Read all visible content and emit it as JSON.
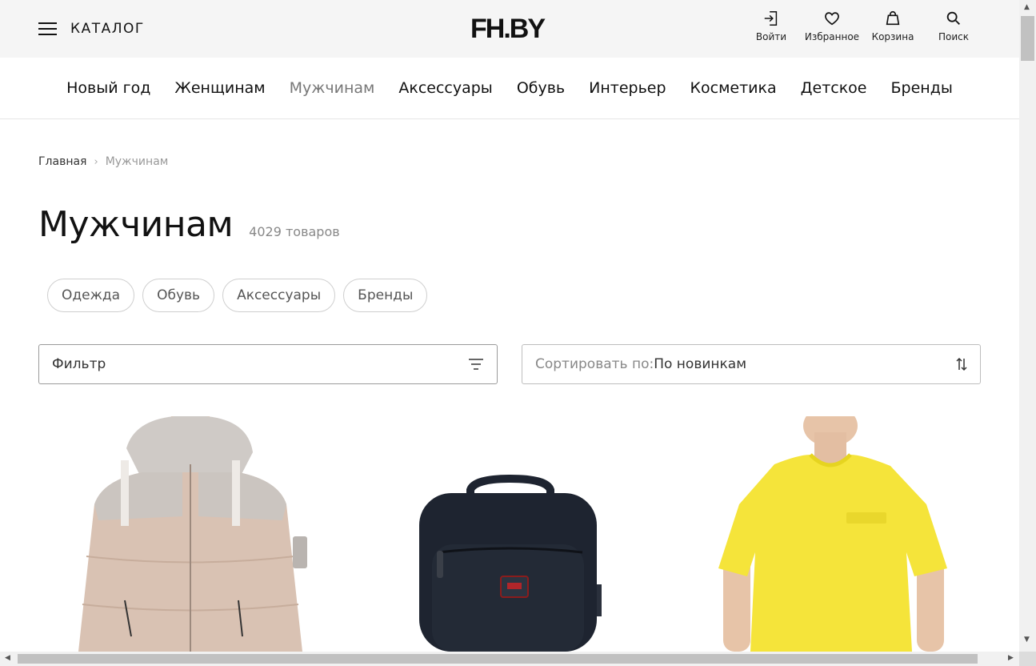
{
  "header": {
    "catalog_label": "КАТАЛОГ",
    "logo": "FH.BY",
    "actions": [
      {
        "label": "Войти",
        "icon": "login-icon"
      },
      {
        "label": "Избранное",
        "icon": "heart-icon"
      },
      {
        "label": "Корзина",
        "icon": "bag-icon"
      },
      {
        "label": "Поиск",
        "icon": "search-icon"
      }
    ]
  },
  "nav": {
    "items": [
      "Новый год",
      "Женщинам",
      "Мужчинам",
      "Аксессуары",
      "Обувь",
      "Интерьер",
      "Косметика",
      "Детское",
      "Бренды"
    ],
    "active": "Мужчинам"
  },
  "breadcrumb": {
    "home": "Главная",
    "current": "Мужчинам"
  },
  "page": {
    "title": "Мужчинам",
    "count": "4029 товаров"
  },
  "chips": [
    "Одежда",
    "Обувь",
    "Аксессуары",
    "Бренды"
  ],
  "filter": {
    "label": "Фильтр"
  },
  "sort": {
    "prefix": "Сортировать по:",
    "value": "По новинкам"
  },
  "products": [
    {
      "kind": "puffer-jacket"
    },
    {
      "kind": "backpack"
    },
    {
      "kind": "t-shirt"
    }
  ],
  "colors": {
    "header_bg": "#f5f5f5",
    "active_nav": "#777777",
    "jacket": "#d9c2b3",
    "backpack": "#1e2430",
    "tshirt": "#f5e43a"
  }
}
